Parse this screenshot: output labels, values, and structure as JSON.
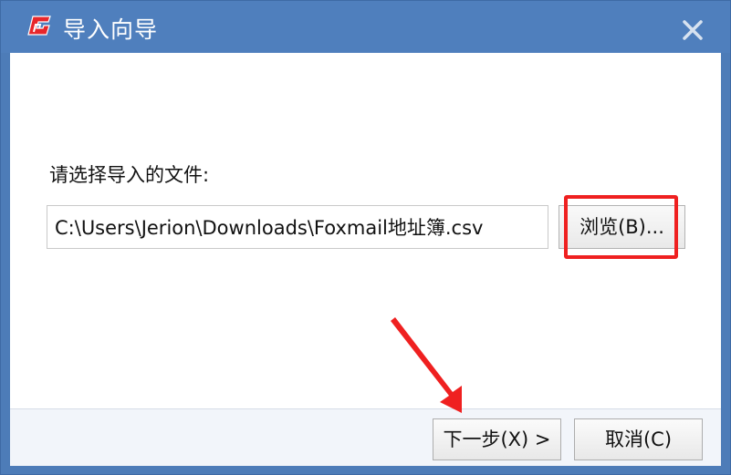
{
  "window": {
    "title": "导入向导",
    "app_icon": "foxmail-logo-icon",
    "close_icon": "close-icon"
  },
  "main": {
    "prompt": "请选择导入的文件:",
    "file_path_value": "C:\\Users\\Jerion\\Downloads\\Foxmail地址簿.csv",
    "browse_label": "浏览(B)..."
  },
  "footer": {
    "next_label": "下一步(X) >",
    "cancel_label": "取消(C)"
  },
  "colors": {
    "titlebar": "#4f7fbd",
    "annotation": "#ef2020",
    "footer_bg": "#f2f5fa"
  }
}
